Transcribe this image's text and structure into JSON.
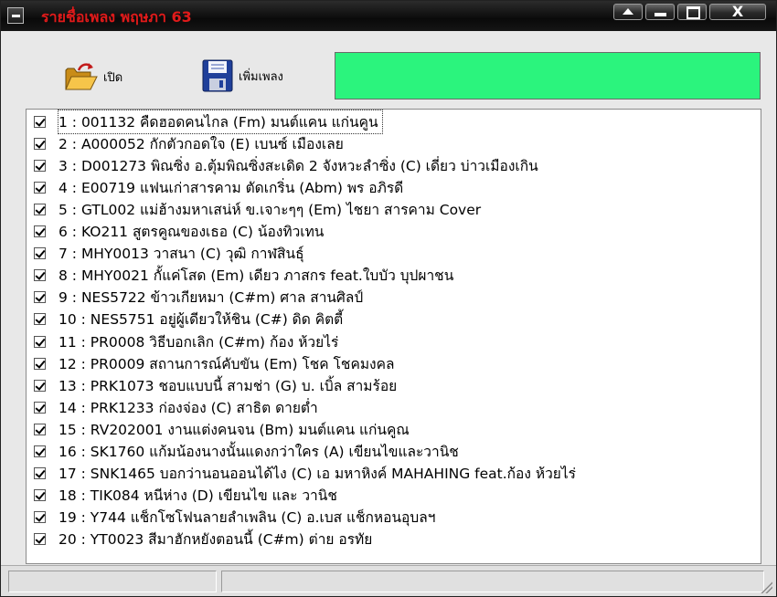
{
  "window": {
    "title": "รายชื่อเพลง พฤษภา 63",
    "close_label": "X"
  },
  "toolbar": {
    "open_label": "เปิด",
    "open_icon": "folder-open-icon",
    "add_label": "เพิ่มเพลง",
    "add_icon": "floppy-disk-icon",
    "status_color": "#2bf47d"
  },
  "songs": [
    {
      "checked": true,
      "text": "1 : 001132 คืดฮอดคนไกล  (Fm) มนต์แคน แก่นคูน"
    },
    {
      "checked": true,
      "text": "2 : A000052 กักตัวกอดใจ (E) เบนซ์  เมืองเลย"
    },
    {
      "checked": true,
      "text": "3 : D001273 พิณซิ่ง อ.ตุ้มพิณซิ่งสะเดิด 2 จังหวะลำซิ่ง (C) เดี่ยว บ่าวเมืองเกิน"
    },
    {
      "checked": true,
      "text": "4 : E00719 แฟนเก่าสารคาม ตัดเกริ่น (Abm) พร อภิรดี"
    },
    {
      "checked": true,
      "text": "5 : GTL002 แม่ฮ้างมหาเสน่ห์ ข.เจาะๆๆ (Em) ไชยา สารคาม Cover"
    },
    {
      "checked": true,
      "text": "6 : KO211 สูตรคูณของเธอ (C) น้องทิวเทน"
    },
    {
      "checked": true,
      "text": "7 : MHY0013 วาสนา (C) วุฒิ กาฬสินธุ์"
    },
    {
      "checked": true,
      "text": "8 : MHY0021 กั้แค่โสด  (Em) เดียว ภาสกร feat.ใบบัว บุปผาชน"
    },
    {
      "checked": true,
      "text": "9 : NES5722 ข้าวเกียหมา (C#m) ศาล สานศิลป์"
    },
    {
      "checked": true,
      "text": "10 : NES5751 อยู่ผู้เดียวให้ชิน (C#) ดิด คิตตี้"
    },
    {
      "checked": true,
      "text": "11 : PR0008 วิธีบอกเลิก (C#m) ก้อง ห้วยไร่"
    },
    {
      "checked": true,
      "text": "12 : PR0009 สถานการณ์คับขัน (Em) โชค โชคมงคล"
    },
    {
      "checked": true,
      "text": "13 : PRK1073 ชอบแบบนี้ สามช่า (G) บ. เบิ้ล สามร้อย"
    },
    {
      "checked": true,
      "text": "14 : PRK1233 ก่องจ่อง (C) สาธิต ดายต่ำ"
    },
    {
      "checked": true,
      "text": "15 : RV202001 งานแต่งคนจน (Bm) มนต์แคน แก่นคูณ"
    },
    {
      "checked": true,
      "text": "16 : SK1760 แก้มน้องนางนั้นแดงกว่าใคร (A) เขียนไขและวานิช"
    },
    {
      "checked": true,
      "text": "17 : SNK1465 บอกว่านอนออนได้ไง (C) เอ มหาหิงค์  MAHAHING feat.ก้อง ห้วยไร่"
    },
    {
      "checked": true,
      "text": "18 : TIK084 หนีห่าง  (D) เขียนไข และ วานิช"
    },
    {
      "checked": true,
      "text": "19 : Y744 แช็กโซโฟนลายลำเพลิน (C) อ.เบส แช็กหอนอุบลฯ"
    },
    {
      "checked": true,
      "text": "20 : YT0023 สีมาฮักหยังตอนนี้ (C#m) ต่าย อรทัย"
    }
  ],
  "statusbar": {
    "panel_1": "",
    "panel_2": ""
  }
}
